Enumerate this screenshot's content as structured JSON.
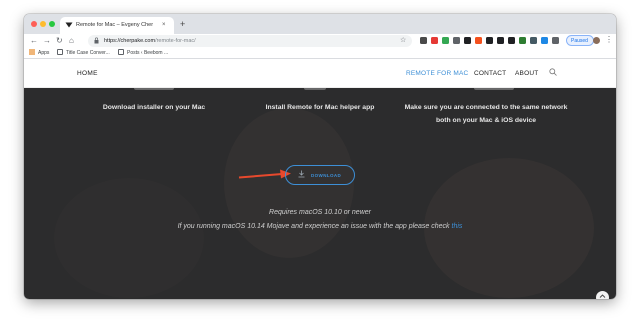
{
  "browser": {
    "tab": {
      "favicon": "cherpake-logo-icon",
      "title": "Remote for Mac – Evgeny Cher",
      "close": "×"
    },
    "new_tab": "+",
    "nav": {
      "back": "←",
      "forward": "→",
      "reload": "↻",
      "home": "⌂"
    },
    "url_host": "https://cherpake.com",
    "url_path": "/remote-for-mac/",
    "star": "☆",
    "paused_label": "Paused",
    "menu": "⋮",
    "extension_colors": [
      "#4a4a4a",
      "#e53935",
      "#34a853",
      "#5f6368",
      "#202124",
      "#f4511e",
      "#202124",
      "#202124",
      "#202124",
      "#2e7d32",
      "#455a64",
      "#1e88e5",
      "#5f6368"
    ]
  },
  "bookmarks": [
    {
      "icon": "apps-grid-icon",
      "label": "Apps"
    },
    {
      "icon": "file-icon",
      "label": "Title Case Conver..."
    },
    {
      "icon": "file-icon",
      "label": "Posts ‹ Beebom ..."
    }
  ],
  "site_nav": {
    "home": "HOME",
    "links": [
      "REMOTE FOR MAC",
      "CONTACT",
      "ABOUT"
    ],
    "active": "REMOTE FOR MAC"
  },
  "steps": [
    "Download installer on your Mac",
    "Install Remote for Mac helper app",
    "Make sure you are connected to the same network both on your Mac & iOS device"
  ],
  "download": {
    "icon": "download-icon",
    "label": "DOWNLOAD"
  },
  "requirement": "Requires macOS 10.10 or newer",
  "issue_text": "If you running macOS 10.14 Mojave and experience an issue with the app please check ",
  "issue_link": "this",
  "colors": {
    "accent": "#3d8fd6",
    "hero_bg": "#2c2c2d",
    "arrow": "#e8492d"
  }
}
